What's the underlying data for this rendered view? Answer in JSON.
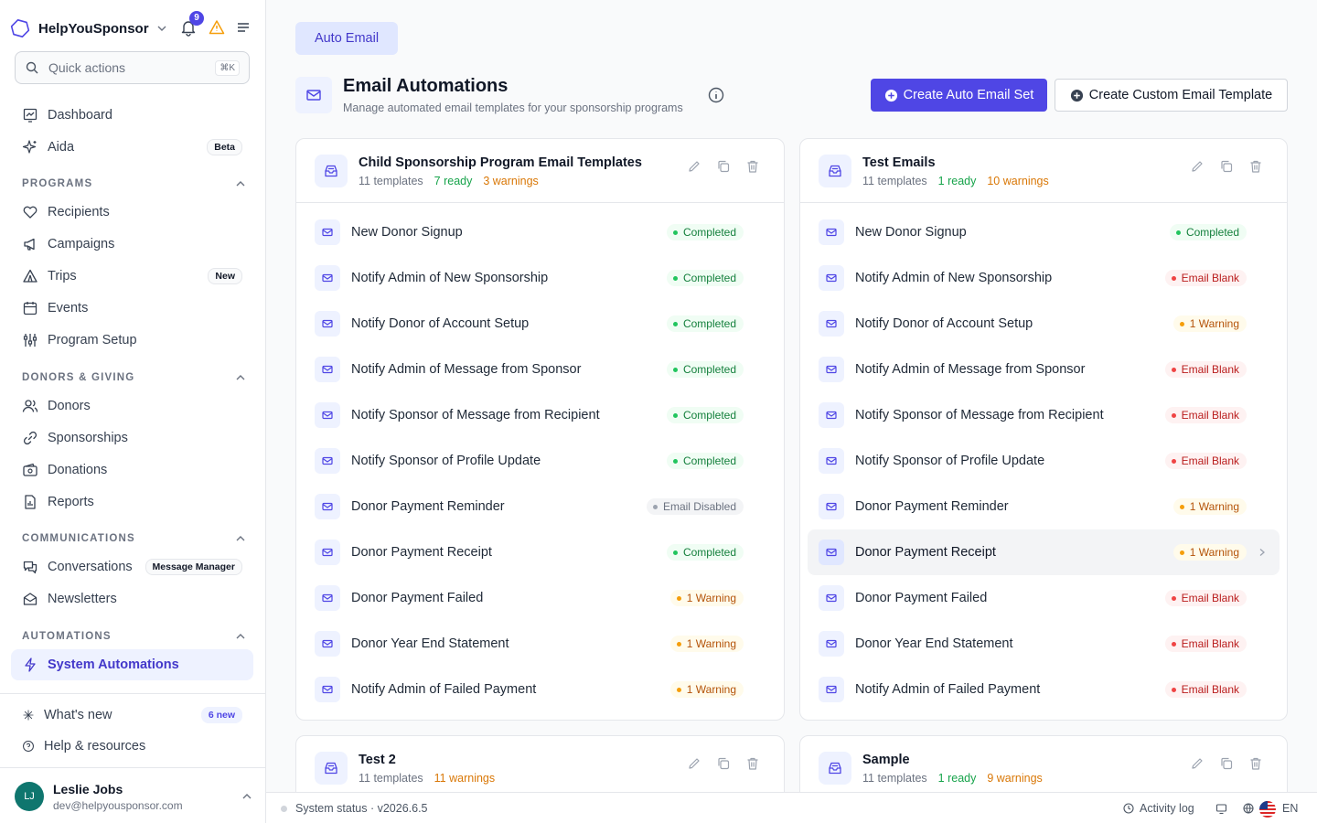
{
  "sidebar": {
    "brand": "HelpYouSponsor",
    "notification_count": "9",
    "quick_actions": {
      "placeholder": "Quick actions",
      "shortcut": "⌘K"
    },
    "items_top": [
      {
        "label": "Dashboard",
        "icon": "dashboard-icon"
      },
      {
        "label": "Aida",
        "icon": "sparkles-icon",
        "tag": "Beta"
      }
    ],
    "sections": [
      {
        "title": "PROGRAMS",
        "items": [
          {
            "label": "Recipients",
            "icon": "heart-icon"
          },
          {
            "label": "Campaigns",
            "icon": "megaphone-icon"
          },
          {
            "label": "Trips",
            "icon": "tent-icon",
            "tag": "New"
          },
          {
            "label": "Events",
            "icon": "calendar-icon"
          },
          {
            "label": "Program Setup",
            "icon": "sliders-icon"
          }
        ]
      },
      {
        "title": "DONORS & GIVING",
        "items": [
          {
            "label": "Donors",
            "icon": "users-icon"
          },
          {
            "label": "Sponsorships",
            "icon": "link-icon"
          },
          {
            "label": "Donations",
            "icon": "wallet-icon"
          },
          {
            "label": "Reports",
            "icon": "report-icon"
          }
        ]
      },
      {
        "title": "COMMUNICATIONS",
        "items": [
          {
            "label": "Conversations",
            "icon": "chat-icon",
            "tag": "Message Manager"
          },
          {
            "label": "Newsletters",
            "icon": "envelope-open-icon"
          }
        ]
      },
      {
        "title": "AUTOMATIONS",
        "items": [
          {
            "label": "System Automations",
            "icon": "bolt-icon",
            "active": true
          }
        ]
      }
    ],
    "bottom": [
      {
        "label": "What's new",
        "icon": "sparkle-icon",
        "tag": "6 new"
      },
      {
        "label": "Help & resources",
        "icon": "help-icon"
      }
    ],
    "user": {
      "initials": "LJ",
      "name": "Leslie Jobs",
      "email": "dev@helpyousponsor.com"
    }
  },
  "main": {
    "tab": "Auto Email",
    "title": "Email Automations",
    "subtitle": "Manage automated email templates for your sponsorship programs",
    "primary_button": "Create Auto Email Set",
    "secondary_button": "Create Custom Email Template"
  },
  "cards": [
    {
      "title": "Child Sponsorship Program Email Templates",
      "templates": "11 templates",
      "ready": "7 ready",
      "warnings": "3 warnings",
      "rows": [
        {
          "name": "New Donor Signup",
          "status": "Completed",
          "kind": "completed"
        },
        {
          "name": "Notify Admin of New Sponsorship",
          "status": "Completed",
          "kind": "completed"
        },
        {
          "name": "Notify Donor of Account Setup",
          "status": "Completed",
          "kind": "completed"
        },
        {
          "name": "Notify Admin of Message from Sponsor",
          "status": "Completed",
          "kind": "completed"
        },
        {
          "name": "Notify Sponsor of Message from Recipient",
          "status": "Completed",
          "kind": "completed"
        },
        {
          "name": "Notify Sponsor of Profile Update",
          "status": "Completed",
          "kind": "completed"
        },
        {
          "name": "Donor Payment Reminder",
          "status": "Email Disabled",
          "kind": "disabled"
        },
        {
          "name": "Donor Payment Receipt",
          "status": "Completed",
          "kind": "completed"
        },
        {
          "name": "Donor Payment Failed",
          "status": "1 Warning",
          "kind": "warning"
        },
        {
          "name": "Donor Year End Statement",
          "status": "1 Warning",
          "kind": "warning"
        },
        {
          "name": "Notify Admin of Failed Payment",
          "status": "1 Warning",
          "kind": "warning"
        }
      ]
    },
    {
      "title": "Test Emails",
      "templates": "11 templates",
      "ready": "1 ready",
      "warnings": "10 warnings",
      "rows": [
        {
          "name": "New Donor Signup",
          "status": "Completed",
          "kind": "completed"
        },
        {
          "name": "Notify Admin of New Sponsorship",
          "status": "Email Blank",
          "kind": "blank"
        },
        {
          "name": "Notify Donor of Account Setup",
          "status": "1 Warning",
          "kind": "warning"
        },
        {
          "name": "Notify Admin of Message from Sponsor",
          "status": "Email Blank",
          "kind": "blank"
        },
        {
          "name": "Notify Sponsor of Message from Recipient",
          "status": "Email Blank",
          "kind": "blank"
        },
        {
          "name": "Notify Sponsor of Profile Update",
          "status": "Email Blank",
          "kind": "blank"
        },
        {
          "name": "Donor Payment Reminder",
          "status": "1 Warning",
          "kind": "warning"
        },
        {
          "name": "Donor Payment Receipt",
          "status": "1 Warning",
          "kind": "warning",
          "hover": true
        },
        {
          "name": "Donor Payment Failed",
          "status": "Email Blank",
          "kind": "blank"
        },
        {
          "name": "Donor Year End Statement",
          "status": "Email Blank",
          "kind": "blank"
        },
        {
          "name": "Notify Admin of Failed Payment",
          "status": "Email Blank",
          "kind": "blank"
        }
      ]
    },
    {
      "title": "Test 2",
      "templates": "11 templates",
      "ready": "",
      "warnings": "11 warnings",
      "rows": []
    },
    {
      "title": "Sample",
      "templates": "11 templates",
      "ready": "1 ready",
      "warnings": "9 warnings",
      "rows": []
    }
  ],
  "footer": {
    "status": "System status · v2026.6.5",
    "activity": "Activity log",
    "language": "EN"
  },
  "colors": {
    "accent": "#4f46e5",
    "accent_light": "#eef2ff",
    "success": "#15803d",
    "warning": "#b45309",
    "danger": "#b91c1c"
  }
}
